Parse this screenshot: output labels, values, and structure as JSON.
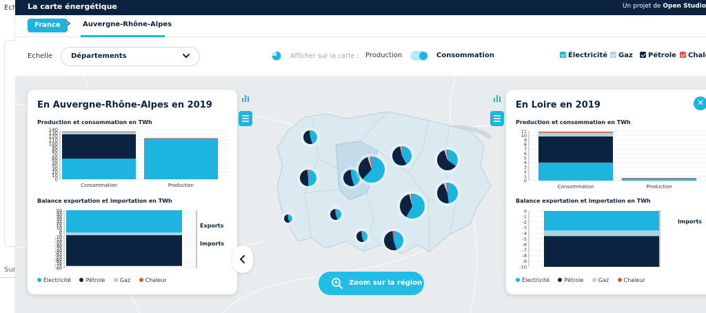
{
  "background_page": {
    "echelle_fragment": "Ech",
    "search_fragment": "Sur"
  },
  "app": {
    "title": "La carte énergétique",
    "project_prefix": "Un projet de",
    "project_org": "Open Studio"
  },
  "breadcrumb": {
    "root": "France",
    "current": "Auvergne-Rhône-Alpes"
  },
  "controls": {
    "scale_label": "Echelle",
    "scale_value": "Départements",
    "display_label": "Afficher sur la carte :",
    "production_label": "Production",
    "consumption_label": "Consommation",
    "toggle_selected": "Consommation",
    "filters": [
      {
        "label": "Électricité",
        "checked": true,
        "color": "#1db4e0"
      },
      {
        "label": "Gaz",
        "checked": true,
        "color": "#a9d3e3"
      },
      {
        "label": "Pétrole",
        "checked": true,
        "color": "#0b2340"
      },
      {
        "label": "Chaleur",
        "checked": true,
        "color": "#e2533f"
      }
    ]
  },
  "colors": {
    "electricite": "#1db4e0",
    "petrole": "#0b2340",
    "gaz": "#a9d3e3",
    "chaleur": "#e2533f",
    "accent": "#1db4e0",
    "dark": "#0b2340"
  },
  "icons": [
    "bar-chart-icon",
    "table-icon",
    "close-icon",
    "chevron-left-icon",
    "zoom-icon",
    "chevron-down-icon",
    "pie-icon"
  ],
  "left_panel": {
    "title": "En Auvergne-Rhône-Alpes en 2019",
    "prodcons_title": "Production et consommation en TWh",
    "balance_title": "Balance exportation et importation en TWh",
    "exports_label": "Exports",
    "imports_label": "Imports",
    "legend": [
      "Électricité",
      "Pétrole",
      "Gaz",
      "Chaleur"
    ]
  },
  "right_panel": {
    "title": "En Loire en 2019",
    "prodcons_title": "Production et consommation en TWh",
    "balance_title": "Balance exportation et importation en TWh",
    "imports_label": "Imports",
    "legend": [
      "Électricité",
      "Pétrole",
      "Gaz",
      "Chaleur"
    ]
  },
  "zoom_button": {
    "label": "Zoom sur la région"
  },
  "chart_data": [
    {
      "type": "bar",
      "stacked": true,
      "title": "Production et consommation en TWh",
      "categories": [
        "Consommation",
        "Production"
      ],
      "yticks": [
        0,
        10,
        20,
        30,
        40,
        50,
        60,
        70,
        80,
        90,
        100,
        110,
        120,
        130,
        140
      ],
      "ylim": [
        0,
        140
      ],
      "series": [
        {
          "name": "Électricité",
          "values": [
            58,
            115
          ]
        },
        {
          "name": "Pétrole",
          "values": [
            69,
            0
          ]
        },
        {
          "name": "Gaz",
          "values": [
            6,
            0
          ]
        },
        {
          "name": "Chaleur",
          "values": [
            2,
            1
          ]
        }
      ]
    },
    {
      "type": "bar",
      "stacked": true,
      "title": "Balance exportation et importation en TWh",
      "categories": [
        "Exports",
        "Imports"
      ],
      "yticks": [
        50,
        45,
        40,
        35,
        30,
        25,
        20,
        15,
        10,
        5,
        0,
        -5,
        -10,
        -15,
        -20,
        -25,
        -30,
        -35,
        -40,
        -45,
        -50,
        -55,
        -60,
        -65,
        -70,
        -75,
        -80
      ],
      "ylim": [
        -80,
        50
      ],
      "series": [
        {
          "name": "Électricité",
          "values": [
            50,
            0
          ]
        },
        {
          "name": "Gaz",
          "values": [
            0,
            -6
          ]
        },
        {
          "name": "Pétrole",
          "values": [
            0,
            -69
          ]
        }
      ]
    },
    {
      "type": "bar",
      "stacked": true,
      "title": "Production et consommation en TWh",
      "categories": [
        "Consommation",
        "Production"
      ],
      "yticks": [
        0,
        1,
        2,
        3,
        4,
        5,
        6,
        7,
        8,
        9,
        10,
        11
      ],
      "ylim": [
        0,
        11
      ],
      "series": [
        {
          "name": "Électricité",
          "values": [
            4,
            0.5
          ]
        },
        {
          "name": "Pétrole",
          "values": [
            5.8,
            0
          ]
        },
        {
          "name": "Gaz",
          "values": [
            0.8,
            0
          ]
        },
        {
          "name": "Chaleur",
          "values": [
            0.25,
            0.1
          ]
        }
      ]
    },
    {
      "type": "bar",
      "stacked": true,
      "title": "Balance exportation et importation en TWh",
      "categories": [
        "Imports"
      ],
      "yticks": [
        0,
        -1,
        -2,
        -3,
        -4,
        -5,
        -6,
        -7,
        -8,
        -9,
        -10
      ],
      "ylim": [
        -10,
        0
      ],
      "series": [
        {
          "name": "Électricité",
          "values": [
            -3.5
          ]
        },
        {
          "name": "Gaz",
          "values": [
            -1
          ]
        },
        {
          "name": "Pétrole",
          "values": [
            -5.5
          ]
        }
      ]
    }
  ],
  "map_pies": [
    {
      "size": 1,
      "shares": [
        0.45,
        0.53,
        0.0,
        0.02
      ]
    },
    {
      "size": 1.1,
      "shares": [
        0.5,
        0.48,
        0.0,
        0.02
      ]
    },
    {
      "size": 1.15,
      "shares": [
        0.45,
        0.53,
        0.0,
        0.02
      ]
    },
    {
      "size": 1.8,
      "shares": [
        0.62,
        0.33,
        0.03,
        0.02
      ]
    },
    {
      "size": 1.25,
      "shares": [
        0.42,
        0.55,
        0.02,
        0.01
      ]
    },
    {
      "size": 1.35,
      "shares": [
        0.35,
        0.6,
        0.03,
        0.02
      ]
    },
    {
      "size": 1.35,
      "shares": [
        0.48,
        0.46,
        0.04,
        0.02
      ]
    },
    {
      "size": 1.7,
      "shares": [
        0.58,
        0.38,
        0.02,
        0.02
      ]
    },
    {
      "size": 0.8,
      "shares": [
        0.45,
        0.53,
        0.0,
        0.02
      ]
    },
    {
      "size": 0.6,
      "shares": [
        0.45,
        0.53,
        0.0,
        0.02
      ]
    },
    {
      "size": 0.75,
      "shares": [
        0.45,
        0.53,
        0.0,
        0.02
      ]
    },
    {
      "size": 1.25,
      "shares": [
        0.45,
        0.53,
        0.0,
        0.02
      ]
    }
  ]
}
